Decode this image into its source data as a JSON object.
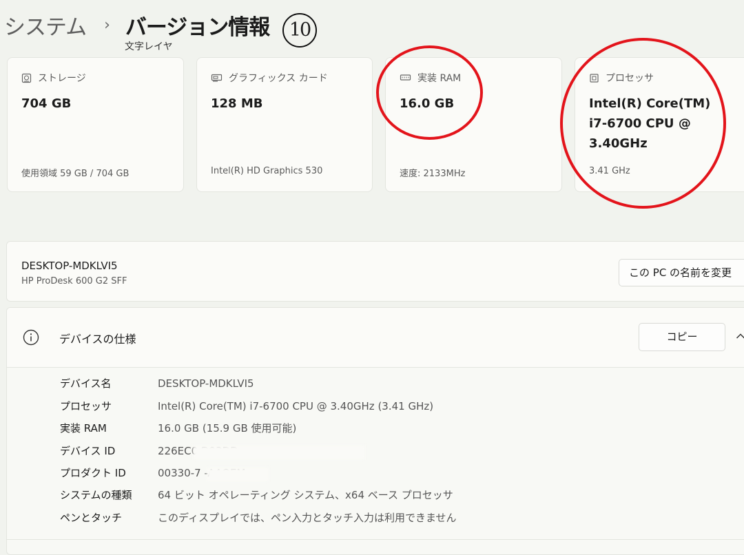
{
  "breadcrumb": {
    "parent": "システム",
    "separator": "›",
    "current": "バージョン情報"
  },
  "annotation": {
    "number": "10",
    "label": "文字レイヤ",
    "highlight_color": "#e3141b"
  },
  "cards": [
    {
      "icon": "storage-icon",
      "title": "ストレージ",
      "value": "704 GB",
      "sub": "使用領域 59 GB / 704 GB"
    },
    {
      "icon": "graphics-card-icon",
      "title": "グラフィックス カード",
      "value": "128 MB",
      "sub": "Intel(R) HD Graphics 530"
    },
    {
      "icon": "ram-icon",
      "title": "実装 RAM",
      "value": "16.0 GB",
      "sub": "速度: 2133MHz"
    },
    {
      "icon": "processor-icon",
      "title": "プロセッサ",
      "value": "Intel(R) Core(TM) i7-6700 CPU @ 3.40GHz",
      "sub": "3.41 GHz"
    }
  ],
  "device": {
    "name": "DESKTOP-MDKLVI5",
    "model": "HP ProDesk 600 G2 SFF",
    "rename_button": "この PC の名前を変更"
  },
  "specs": {
    "icon": "info-icon",
    "title": "デバイスの仕様",
    "copy_button": "コピー",
    "rows": [
      {
        "label": "デバイス名",
        "value": "DESKTOP-MDKLVI5"
      },
      {
        "label": "プロセッサ",
        "value": "Intel(R) Core(TM) i7-6700 CPU @ 3.40GHz   (3.41 GHz)"
      },
      {
        "label": "実装 RAM",
        "value": "16.0 GB (15.9 GB 使用可能)"
      },
      {
        "label": "デバイス ID",
        "value": "226EC0                                               D93DD"
      },
      {
        "label": "プロダクト ID",
        "value": "00330-7              -AAOEM"
      },
      {
        "label": "システムの種類",
        "value": "64 ビット オペレーティング システム、x64 ベース プロセッサ"
      },
      {
        "label": "ペンとタッチ",
        "value": "このディスプレイでは、ペン入力とタッチ入力は利用できません"
      }
    ]
  }
}
